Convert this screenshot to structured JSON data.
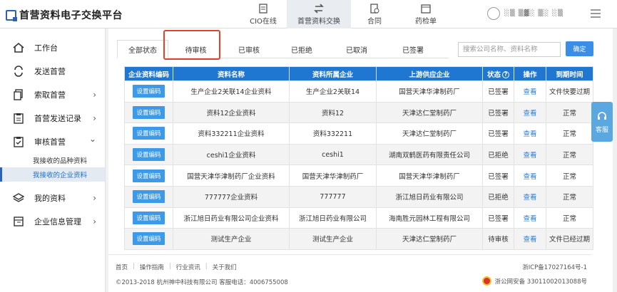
{
  "app": {
    "logo_text": "首营资料电子交换平台"
  },
  "nav": [
    {
      "label": "CIO在线",
      "icon": "document-icon"
    },
    {
      "label": "首营资料交换",
      "icon": "exchange-icon",
      "active": true
    },
    {
      "label": "合同",
      "icon": "contract-icon"
    },
    {
      "label": "药检单",
      "icon": "report-icon"
    }
  ],
  "user": {
    "name": "░▒ ▒▓░ ▒░ ░▒"
  },
  "sidebar": {
    "items": [
      {
        "label": "工作台",
        "icon": "home-icon"
      },
      {
        "label": "发送首营",
        "icon": "send-icon"
      },
      {
        "label": "索取首营",
        "icon": "request-icon",
        "chevron": "›"
      },
      {
        "label": "首营发送记录",
        "icon": "record-icon",
        "chevron": "›"
      },
      {
        "label": "审核首营",
        "icon": "audit-icon",
        "chevron": "⌄"
      }
    ],
    "sub_items": [
      {
        "label": "我接收的品种资料"
      },
      {
        "label": "我接收的企业资料",
        "active": true
      }
    ],
    "items2": [
      {
        "label": "我的资料",
        "icon": "layers-icon",
        "chevron": "›"
      },
      {
        "label": "企业信息管理",
        "icon": "company-icon",
        "chevron": "›"
      }
    ]
  },
  "tabs": [
    {
      "label": "全部状态",
      "active": true
    },
    {
      "label": "待审核"
    },
    {
      "label": "已审核"
    },
    {
      "label": "已拒绝"
    },
    {
      "label": "已取消"
    },
    {
      "label": "已签署"
    }
  ],
  "search": {
    "placeholder": "搜索公司名称、资料名称",
    "button": "确定"
  },
  "table": {
    "headers": [
      "企业资料编码",
      "资料名称",
      "资料所属企业",
      "上游供应企业",
      "状态",
      "操作",
      "到期时间"
    ],
    "code_button": "设置编码",
    "view_link": "查看",
    "status_help": "?",
    "rows": [
      [
        "生产企业2关联14企业资料",
        "生产企业2关联14",
        "国营天津华津制药厂",
        "已签署",
        "文件快要过期"
      ],
      [
        "资料12企业资料",
        "资料12",
        "天津达仁堂制药厂",
        "已签署",
        "正常"
      ],
      [
        "资料332211企业资料",
        "资料332211",
        "天津达仁堂制药厂",
        "已签署",
        "正常"
      ],
      [
        "ceshi1企业资料",
        "ceshi1",
        "湖南双鹤医药有限责任公司",
        "已拒绝",
        "正常"
      ],
      [
        "国营天津华津制药厂企业资料",
        "国营天津华津制药厂",
        "国营天津华津制药厂",
        "已签署",
        "正常"
      ],
      [
        "777777企业资料",
        "777777",
        "浙江旭日药业有限公司",
        "已拒绝",
        "正常"
      ],
      [
        "浙江旭日药业有限公司企业资料",
        "浙江旭日药业有限公司",
        "海南胜元园林工程有限公司",
        "已签署",
        "正常"
      ],
      [
        "测试生产企业",
        "测试生产企业",
        "天津达仁堂制药厂",
        "待审核",
        "文件已经过期"
      ]
    ]
  },
  "service": {
    "label": "客服"
  },
  "footer": {
    "links": [
      "首页",
      "操作指南",
      "行业资讯",
      "关于我们"
    ],
    "copyright": "©2013-2018  杭州神中科技有限公司  客服电话：4006755008",
    "icp": "浙ICP备17027164号-1",
    "police": "浙公网安备 33011002013088号"
  }
}
